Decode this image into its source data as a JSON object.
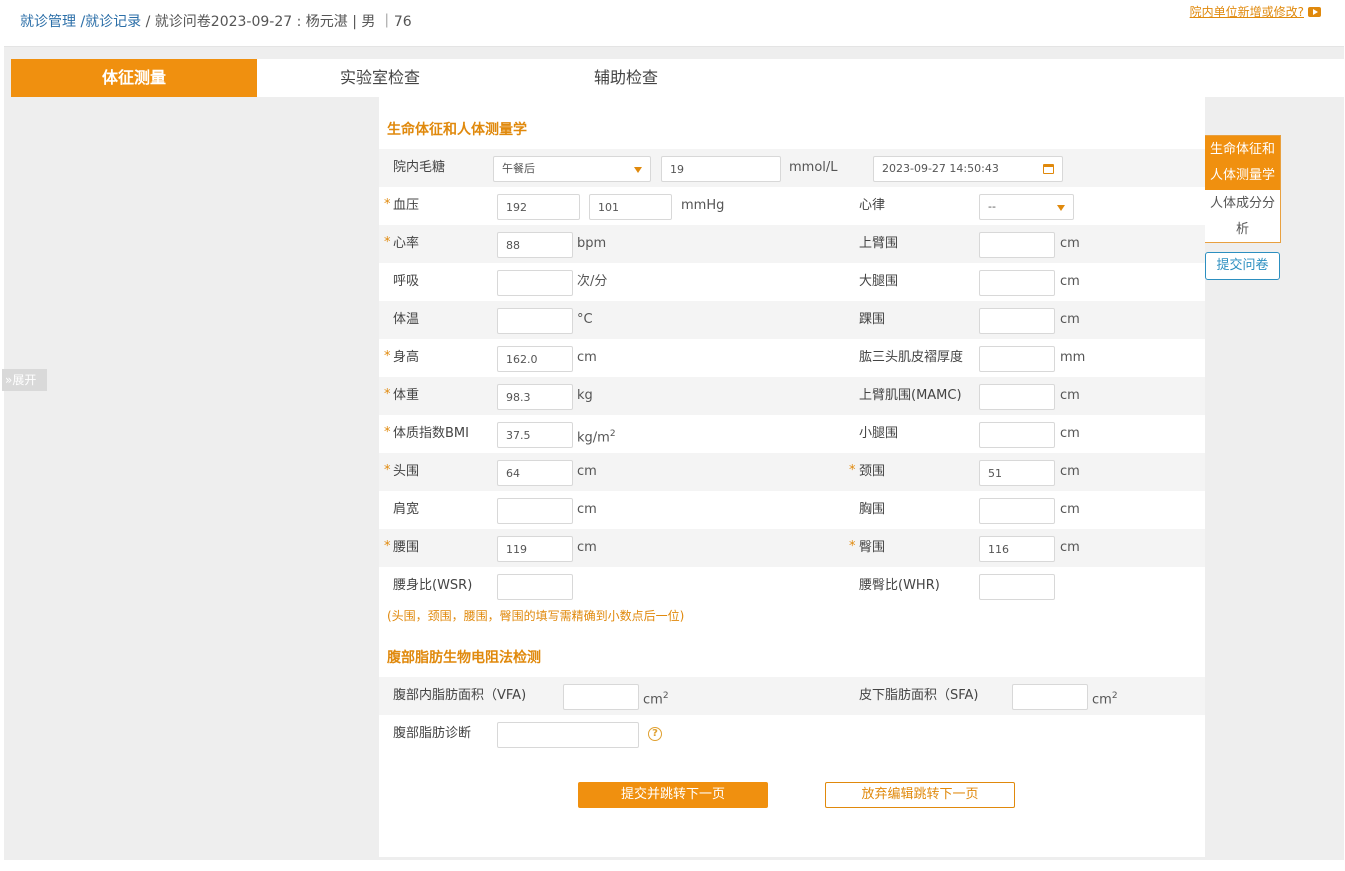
{
  "breadcrumb": {
    "item1": "就诊管理",
    "item2": "/就诊记录",
    "current": "/ 就诊问卷2023-09-27 : 杨元湛 | 男 ｜76"
  },
  "top_link": "院内单位新增或修改?",
  "tabs": [
    "体征测量",
    "实验室检查",
    "辅助检查"
  ],
  "expand_label": "展开",
  "section1": {
    "title": "生命体征和人体测量学",
    "glucose": {
      "label": "院内毛糖",
      "meal": "午餐后",
      "value": "19",
      "unit": "mmol/L",
      "datetime": "2023-09-27 14:50:43"
    },
    "bp": {
      "label": "血压",
      "systolic": "192",
      "diastolic": "101",
      "unit": "mmHg"
    },
    "rhythm": {
      "label": "心律",
      "value": "--"
    },
    "hr": {
      "label": "心率",
      "value": "88",
      "unit": "bpm"
    },
    "upper_arm": {
      "label": "上臂围",
      "value": "",
      "unit": "cm"
    },
    "resp": {
      "label": "呼吸",
      "value": "",
      "unit": "次/分"
    },
    "thigh": {
      "label": "大腿围",
      "value": "",
      "unit": "cm"
    },
    "temp": {
      "label": "体温",
      "value": "",
      "unit": "°C"
    },
    "ankle": {
      "label": "踝围",
      "value": "",
      "unit": "cm"
    },
    "height": {
      "label": "身高",
      "value": "162.0",
      "unit": "cm"
    },
    "triceps": {
      "label": "肱三头肌皮褶厚度",
      "value": "",
      "unit": "mm"
    },
    "weight": {
      "label": "体重",
      "value": "98.3",
      "unit": "kg"
    },
    "mamc": {
      "label": "上臂肌围(MAMC)",
      "value": "",
      "unit": "cm"
    },
    "bmi": {
      "label": "体质指数BMI",
      "value": "37.5",
      "unit": "kg/m",
      "unit_sup": "2"
    },
    "calf": {
      "label": "小腿围",
      "value": "",
      "unit": "cm"
    },
    "head": {
      "label": "头围",
      "value": "64",
      "unit": "cm"
    },
    "neck": {
      "label": "颈围",
      "value": "51",
      "unit": "cm"
    },
    "shoulder": {
      "label": "肩宽",
      "value": "",
      "unit": "cm"
    },
    "chest": {
      "label": "胸围",
      "value": "",
      "unit": "cm"
    },
    "waist": {
      "label": "腰围",
      "value": "119",
      "unit": "cm"
    },
    "hip": {
      "label": "臀围",
      "value": "116",
      "unit": "cm"
    },
    "wsr": {
      "label": "腰身比(WSR)",
      "value": ""
    },
    "whr": {
      "label": "腰臀比(WHR)",
      "value": ""
    },
    "note": "(头围，颈围，腰围，臀围的填写需精确到小数点后一位)",
    "required_mark": "*"
  },
  "section2": {
    "title": "腹部脂肪生物电阻法检测",
    "vfa": {
      "label": "腹部内脂肪面积（VFA)",
      "value": "",
      "unit": "cm",
      "unit_sup": "2"
    },
    "sfa": {
      "label": "皮下脂肪面积（SFA)",
      "value": "",
      "unit": "cm",
      "unit_sup": "2"
    },
    "diagnosis": {
      "label": "腹部脂肪诊断",
      "value": ""
    },
    "help_glyph": "?"
  },
  "buttons": {
    "submit_next": "提交并跳转下一页",
    "discard_next": "放弃编辑跳转下一页"
  },
  "side_nav": {
    "items": [
      "生命体征和人体测量学",
      "人体成分分析"
    ],
    "submit": "提交问卷"
  },
  "colors": {
    "accent": "#f0900f",
    "link": "#2c6fa8",
    "submit_blue": "#2c8fc0"
  }
}
